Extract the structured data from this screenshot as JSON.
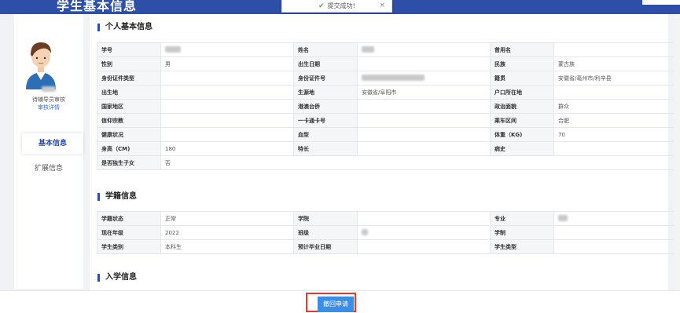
{
  "header": {
    "title": "学生基本信息"
  },
  "toast": {
    "message": "提交成功!",
    "close": "×"
  },
  "sidebar": {
    "status": "待辅导员审核",
    "review_link": "审核详情",
    "nav": [
      {
        "label": "基本信息"
      },
      {
        "label": "扩展信息"
      }
    ]
  },
  "section_basic": {
    "title": "个人基本信息",
    "rows": [
      [
        "学号",
        "",
        "姓名",
        "",
        "曾用名",
        ""
      ],
      [
        "性别",
        "男",
        "出生日期",
        "",
        "民族",
        "蒙古族"
      ],
      [
        "身份证件类型",
        "",
        "身份证件号",
        "",
        "籍贯",
        "安徽省/亳州市/利辛县"
      ],
      [
        "出生地",
        "",
        "生源地",
        "安徽省/阜阳市",
        "户口所在地",
        ""
      ],
      [
        "国家地区",
        "",
        "港澳台侨",
        "",
        "政治面貌",
        "群众"
      ],
      [
        "信仰宗教",
        "",
        "一卡通卡号",
        "",
        "乘车区间",
        "合肥"
      ],
      [
        "健康状况",
        "",
        "血型",
        "",
        "体重（KG)",
        "70"
      ],
      [
        "身高（CM)",
        "180",
        "特长",
        "",
        "病史",
        ""
      ]
    ],
    "last_row": [
      "是否独生子女",
      "否"
    ]
  },
  "section_school": {
    "title": "学籍信息",
    "rows": [
      [
        "学籍状态",
        "正常",
        "学院",
        "",
        "专业",
        ""
      ],
      [
        "现在年级",
        "2022",
        "班级",
        "",
        "学制",
        ""
      ],
      [
        "学生类别",
        "本科生",
        "预计毕业日期",
        "",
        "学生类型",
        ""
      ]
    ]
  },
  "section_enroll": {
    "title": "入学信息"
  },
  "footer": {
    "revoke_button": "撤回申请"
  },
  "colors": {
    "primary": "#2e4fa8",
    "button": "#3a8ee6",
    "highlight": "#e53935"
  }
}
